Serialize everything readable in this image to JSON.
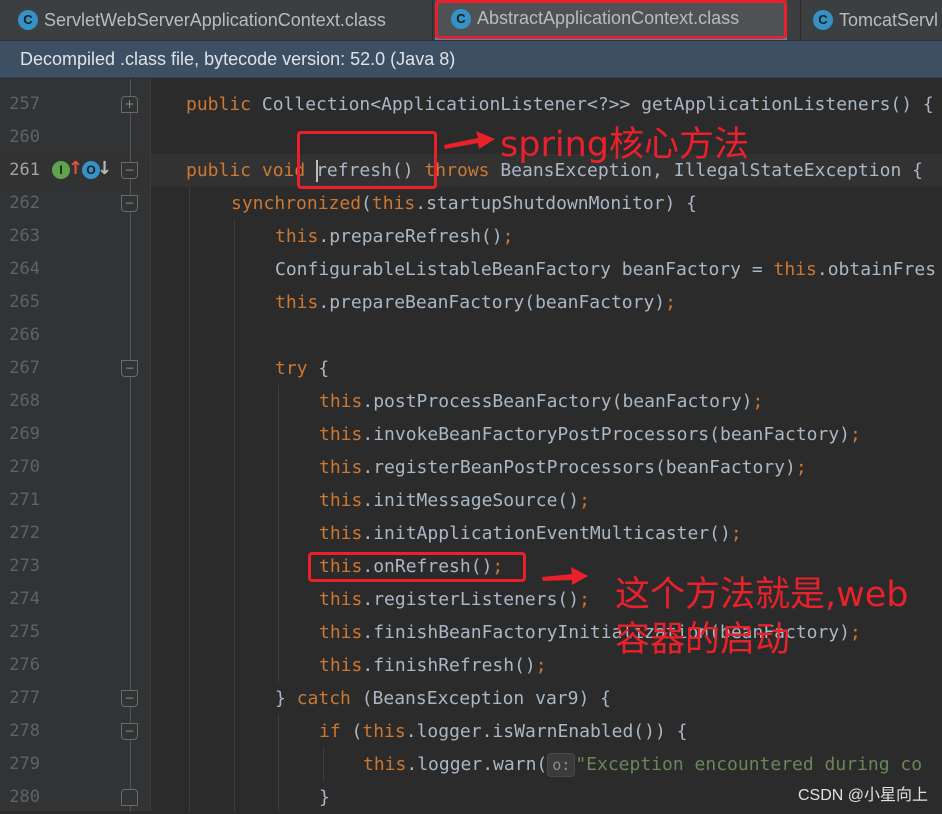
{
  "tabs": [
    {
      "icon": "c-class-icon",
      "glyph": "C",
      "label": "ServletWebServerApplicationContext.class",
      "active": false
    },
    {
      "icon": "c-class-icon",
      "glyph": "C",
      "label": "AbstractApplicationContext.class",
      "active": true
    },
    {
      "icon": "c-class-icon",
      "glyph": "C",
      "label": "TomcatServl",
      "active": false
    }
  ],
  "tab_close_glyph": "×",
  "banner": {
    "text": "Decompiled .class file, bytecode version: 52.0 (Java 8)"
  },
  "gutter_icons": {
    "implements_glyph": "I",
    "overrides_glyph": "O",
    "up_arrow": "↑",
    "down_arrow": "↓"
  },
  "code": {
    "l257": {
      "num": "257",
      "public": "public",
      "rest": " Collection<ApplicationListener<?>> getApplicationListeners() {"
    },
    "l260": {
      "num": "260"
    },
    "l261": {
      "num": "261",
      "public": "public",
      "void": "void",
      "method": "refresh",
      "paren": "()",
      "throws": "throws",
      "rest": " BeansException, IllegalStateException {"
    },
    "l262": {
      "num": "262",
      "kw": "synchronized",
      "open": "(",
      "this": "this",
      "rest": ".startupShutdownMonitor) {"
    },
    "l263": {
      "num": "263",
      "this": "this",
      "rest": ".prepareRefresh()",
      "semi": ";"
    },
    "l264": {
      "num": "264",
      "rest": "ConfigurableListableBeanFactory beanFactory = ",
      "this": "this",
      "tail": ".obtainFres"
    },
    "l265": {
      "num": "265",
      "this": "this",
      "rest": ".prepareBeanFactory(beanFactory)",
      "semi": ";"
    },
    "l266": {
      "num": "266"
    },
    "l267": {
      "num": "267",
      "kw": "try",
      "rest": " {"
    },
    "l268": {
      "num": "268",
      "this": "this",
      "rest": ".postProcessBeanFactory(beanFactory)",
      "semi": ";"
    },
    "l269": {
      "num": "269",
      "this": "this",
      "rest": ".invokeBeanFactoryPostProcessors(beanFactory)",
      "semi": ";"
    },
    "l270": {
      "num": "270",
      "this": "this",
      "rest": ".registerBeanPostProcessors(beanFactory)",
      "semi": ";"
    },
    "l271": {
      "num": "271",
      "this": "this",
      "rest": ".initMessageSource()",
      "semi": ";"
    },
    "l272": {
      "num": "272",
      "this": "this",
      "rest": ".initApplicationEventMulticaster()",
      "semi": ";"
    },
    "l273": {
      "num": "273",
      "this": "this",
      "rest": ".onRefresh()",
      "semi": ";"
    },
    "l274": {
      "num": "274",
      "this": "this",
      "rest": ".registerListeners()",
      "semi": ";"
    },
    "l275": {
      "num": "275",
      "this": "this",
      "rest": ".finishBeanFactoryInitialization(beanFactory)",
      "semi": ";"
    },
    "l276": {
      "num": "276",
      "this": "this",
      "rest": ".finishRefresh()",
      "semi": ";"
    },
    "l277": {
      "num": "277",
      "pre": "} ",
      "kw": "catch",
      "rest": " (BeansException var9) {"
    },
    "l278": {
      "num": "278",
      "kw": "if",
      "open": " (",
      "this": "this",
      "rest": ".logger.isWarnEnabled()) {"
    },
    "l279": {
      "num": "279",
      "this": "this",
      "rest": ".logger.warn(",
      "hint": "o:",
      "str": "\"Exception encountered during co"
    },
    "l280": {
      "num": "280",
      "rest": "}"
    }
  },
  "annotations": {
    "spring_core": "spring核心方法",
    "web_container_line1": "这个方法就是,web",
    "web_container_line2": "容器的启动"
  },
  "watermark": "CSDN @小星向上",
  "colors": {
    "annotation_red": "#e8212b",
    "keyword": "#cc7832",
    "banner_bg": "#3d4f63",
    "editor_bg": "#2b2b2b"
  }
}
